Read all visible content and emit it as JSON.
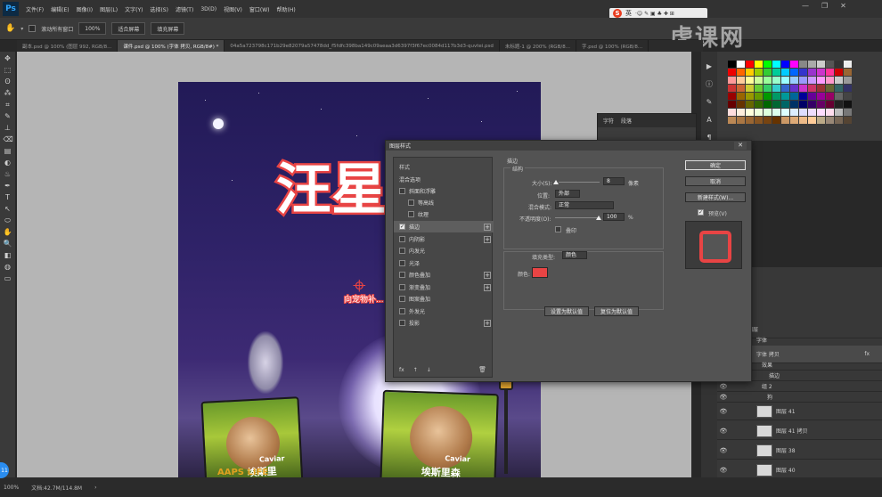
{
  "menubar": {
    "logo": "Ps",
    "items": [
      "文件(F)",
      "编辑(E)",
      "图像(I)",
      "图层(L)",
      "文字(Y)",
      "选择(S)",
      "滤镜(T)",
      "3D(D)",
      "视图(V)",
      "窗口(W)",
      "帮助(H)"
    ],
    "ime": {
      "logo": "S",
      "lang": "英",
      "icons": "·☺ ✎ ▣ ♣ ✚ ⊞"
    }
  },
  "options": {
    "scroll_all": "滚动所有窗口",
    "zoom": "100%",
    "fit_screen": "适合屏幕",
    "fill_screen": "填充屏幕"
  },
  "tabs": [
    {
      "label": "副本.psd @ 100% (图层 992, RGB/8...",
      "active": false
    },
    {
      "label": "课件.psd @ 100% (字体 拷贝, RGB/8#) *",
      "active": true
    },
    {
      "label": "04a5a723798c171b29e82079a57478dd_f5fdfc398ba149c09aeaa3d6397f3f67ec0084d117b3d3-quvtei.psd",
      "active": false
    },
    {
      "label": "未标题-1 @ 200% (RGB/8...",
      "active": false
    },
    {
      "label": "字.psd @ 100% (RGB/8...",
      "active": false
    }
  ],
  "tools": [
    "✥",
    "⬚",
    "ʘ",
    "⁂",
    "⌗",
    "✎",
    "⊥",
    "⌫",
    "▤",
    "◐",
    "♨",
    "✒",
    "T",
    "↖",
    "⬭",
    "✋",
    "🔍",
    "◧",
    "◍",
    "▭"
  ],
  "poster": {
    "title": "汪星的搜",
    "title_mark": "⌖",
    "subtitle": "向宠物补...",
    "bag_brand": "Caviar",
    "bag_cn": "埃斯里",
    "bag2_cn": "埃斯里森",
    "bag_bottom": "AAPS LIFE"
  },
  "char_panel": {
    "tabs": [
      "字符",
      "段落"
    ]
  },
  "dialog": {
    "title": "图层样式",
    "close": "✕",
    "list_header": "样式",
    "blend_options": "混合选项",
    "items": [
      {
        "label": "斜面和浮雕",
        "checked": false,
        "plus": false,
        "indent": 0
      },
      {
        "label": "等高线",
        "checked": false,
        "plus": false,
        "indent": 1
      },
      {
        "label": "纹理",
        "checked": false,
        "plus": false,
        "indent": 1
      },
      {
        "label": "描边",
        "checked": true,
        "plus": true,
        "indent": 0,
        "selected": true
      },
      {
        "label": "内阴影",
        "checked": false,
        "plus": true,
        "indent": 0
      },
      {
        "label": "内发光",
        "checked": false,
        "plus": false,
        "indent": 0
      },
      {
        "label": "光泽",
        "checked": false,
        "plus": false,
        "indent": 0
      },
      {
        "label": "颜色叠加",
        "checked": false,
        "plus": true,
        "indent": 0
      },
      {
        "label": "渐变叠加",
        "checked": false,
        "plus": true,
        "indent": 0
      },
      {
        "label": "图案叠加",
        "checked": false,
        "plus": false,
        "indent": 0
      },
      {
        "label": "外发光",
        "checked": false,
        "plus": false,
        "indent": 0
      },
      {
        "label": "投影",
        "checked": false,
        "plus": true,
        "indent": 0
      }
    ],
    "list_footer": {
      "fx": "fx",
      "up": "↑",
      "down": "↓",
      "trash": "🗑"
    },
    "stroke": {
      "heading": "描边",
      "structure": "结构",
      "size_label": "大小(S):",
      "size_value": "8",
      "size_unit": "像素",
      "position_label": "位置:",
      "position_value": "外部",
      "blend_label": "混合模式:",
      "blend_value": "正常",
      "opacity_label": "不透明度(O):",
      "opacity_value": "100",
      "opacity_unit": "%",
      "overprint_label": "叠印",
      "fill_type_label": "填充类型:",
      "fill_type_value": "颜色",
      "color_label": "颜色:",
      "color_value": "#e84444",
      "set_default": "设置为默认值",
      "reset_default": "复位为默认值"
    },
    "buttons": {
      "ok": "确定",
      "cancel": "取消",
      "new_style": "新建样式(W)...",
      "preview": "预览(V)"
    }
  },
  "layers": [
    {
      "label": "图层",
      "eye": false,
      "thumb": false,
      "indent": 0
    },
    {
      "label": "字体",
      "eye": true,
      "thumb": false,
      "indent": 1
    },
    {
      "label": "字体 拷贝",
      "eye": true,
      "thumb": false,
      "indent": 1,
      "fx": "fx"
    },
    {
      "label": "效果",
      "eye": true,
      "thumb": false,
      "indent": 2
    },
    {
      "label": "描边",
      "eye": true,
      "thumb": false,
      "indent": 3
    },
    {
      "label": "组 2",
      "eye": true,
      "thumb": false,
      "indent": 1
    },
    {
      "label": "狗",
      "eye": true,
      "thumb": false,
      "indent": 2
    },
    {
      "label": "图层 41",
      "eye": true,
      "thumb": true,
      "indent": 3
    },
    {
      "label": "图层 41 拷贝",
      "eye": true,
      "thumb": true,
      "indent": 3
    },
    {
      "label": "图层 38",
      "eye": true,
      "thumb": true,
      "indent": 3
    },
    {
      "label": "图层 40",
      "eye": true,
      "thumb": true,
      "indent": 3
    }
  ],
  "status": {
    "zoom": "100%",
    "doc": "文档:42.7M/114.8M",
    "arrow": "›"
  },
  "badge": "11",
  "watermark": "虎课网",
  "colors": {
    "stroke": "#e84444",
    "canvas_bg": "#b5b5b5",
    "accent": "#31a8ff"
  }
}
